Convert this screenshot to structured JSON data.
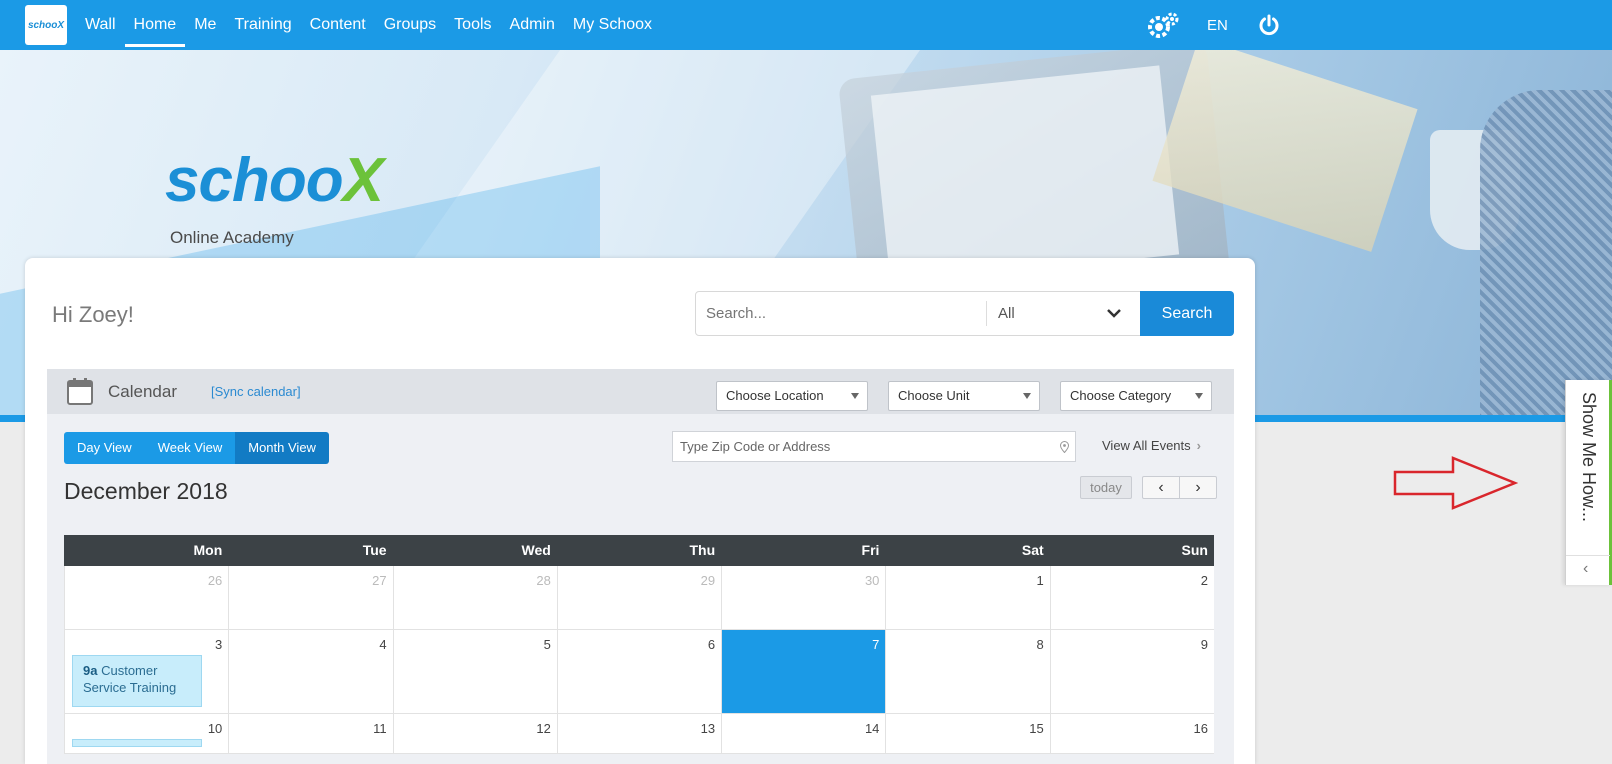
{
  "nav": {
    "logo": "schooX",
    "items": [
      {
        "label": "Wall"
      },
      {
        "label": "Home"
      },
      {
        "label": "Me"
      },
      {
        "label": "Training"
      },
      {
        "label": "Content"
      },
      {
        "label": "Groups"
      },
      {
        "label": "Tools"
      },
      {
        "label": "Admin"
      },
      {
        "label": "My Schoox"
      }
    ],
    "active": "Home",
    "lang": "EN"
  },
  "hero": {
    "brand_main": "schoo",
    "brand_x": "X",
    "subtitle": "Online Academy"
  },
  "main": {
    "greeting": "Hi Zoey!",
    "search": {
      "placeholder": "Search...",
      "scope": "All",
      "button": "Search"
    }
  },
  "calendar": {
    "title": "Calendar",
    "sync": "[Sync calendar]",
    "filters": [
      "Choose Location",
      "Choose Unit",
      "Choose Category"
    ],
    "views": [
      "Day View",
      "Week View",
      "Month View"
    ],
    "active_view": "Month View",
    "zip_placeholder": "Type Zip Code or Address",
    "view_all": "View All Events",
    "month": "December 2018",
    "today": "today",
    "weekdays": [
      "Mon",
      "Tue",
      "Wed",
      "Thu",
      "Fri",
      "Sat",
      "Sun"
    ],
    "weeks": [
      [
        "26",
        "27",
        "28",
        "29",
        "30",
        "1",
        "2"
      ],
      [
        "3",
        "4",
        "5",
        "6",
        "7",
        "8",
        "9"
      ],
      [
        "10",
        "11",
        "12",
        "13",
        "14",
        "15",
        "16"
      ]
    ],
    "event": {
      "time": "9a",
      "title": "Customer Service Training"
    }
  },
  "side_tab": {
    "label": "Show Me How..."
  },
  "colors": {
    "primary": "#1b9ae6",
    "accent": "#6cc23a",
    "today": "#1b9ae6",
    "event_bg": "#c8edfb",
    "arrow": "#d9262c"
  }
}
